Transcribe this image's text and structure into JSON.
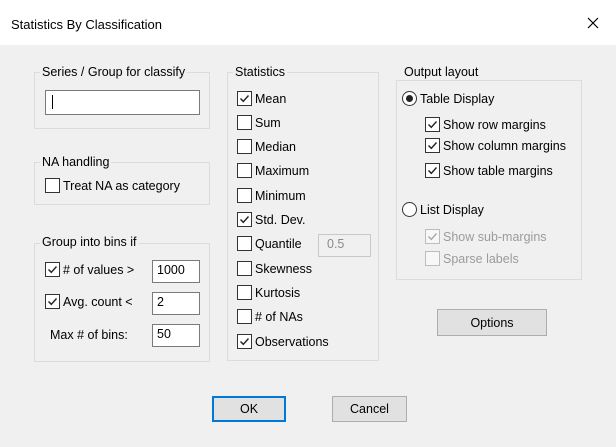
{
  "window": {
    "title": "Statistics By Classification"
  },
  "series_group": {
    "label": "Series / Group for classify",
    "value": ""
  },
  "na_handling": {
    "label": "NA handling",
    "treat_na": {
      "label": "Treat NA as category",
      "checked": false
    }
  },
  "bins": {
    "label": "Group into bins if",
    "num_values": {
      "label": "# of values >",
      "checked": true,
      "value": "1000"
    },
    "avg_count": {
      "label": "Avg. count <",
      "checked": true,
      "value": "2"
    },
    "max_bins": {
      "label": "Max # of bins:",
      "value": "50"
    }
  },
  "statistics": {
    "label": "Statistics",
    "items": [
      {
        "label": "Mean",
        "checked": true
      },
      {
        "label": "Sum",
        "checked": false
      },
      {
        "label": "Median",
        "checked": false
      },
      {
        "label": "Maximum",
        "checked": false
      },
      {
        "label": "Minimum",
        "checked": false
      },
      {
        "label": "Std. Dev.",
        "checked": true
      },
      {
        "label": "Quantile",
        "checked": false
      },
      {
        "label": "Skewness",
        "checked": false
      },
      {
        "label": "Kurtosis",
        "checked": false
      },
      {
        "label": "# of NAs",
        "checked": false
      },
      {
        "label": "Observations",
        "checked": true
      }
    ],
    "quantile_value": "0.5"
  },
  "output_layout": {
    "label": "Output layout",
    "table_display": {
      "label": "Table Display",
      "selected": true
    },
    "show_row_margins": {
      "label": "Show row margins",
      "checked": true
    },
    "show_column_margins": {
      "label": "Show column margins",
      "checked": true
    },
    "show_table_margins": {
      "label": "Show table margins",
      "checked": true
    },
    "list_display": {
      "label": "List Display",
      "selected": false
    },
    "show_sub_margins": {
      "label": "Show sub-margins",
      "checked": true,
      "disabled": true
    },
    "sparse_labels": {
      "label": "Sparse labels",
      "checked": false,
      "disabled": true
    }
  },
  "buttons": {
    "options": "Options",
    "ok": "OK",
    "cancel": "Cancel"
  }
}
